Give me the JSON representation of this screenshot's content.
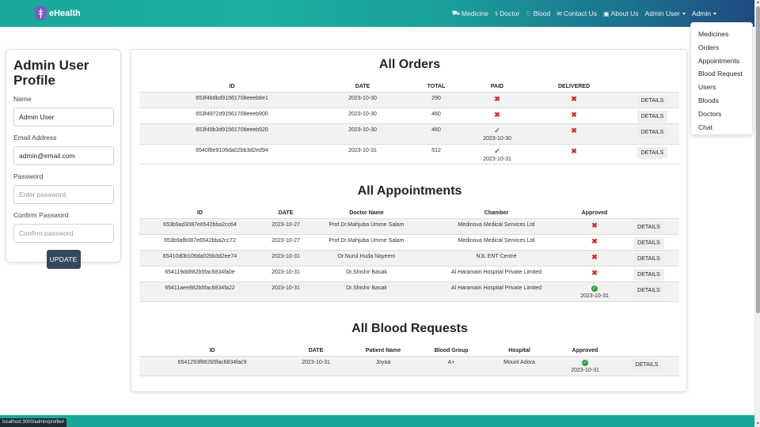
{
  "brand": {
    "name": "eHealth"
  },
  "nav": {
    "links": [
      {
        "label": "Medicine",
        "icon": "truck-medical-icon",
        "glyph": "🚑"
      },
      {
        "label": "Doctor",
        "icon": "stethoscope-icon",
        "glyph": "⚕"
      },
      {
        "label": "Blood",
        "icon": "hand-holding-droplet-icon",
        "glyph": "♡"
      },
      {
        "label": "Contact Us",
        "icon": "envelope-icon",
        "glyph": "✉"
      },
      {
        "label": "About Us",
        "icon": "address-card-icon",
        "glyph": "▣"
      }
    ],
    "admin_user_label": "Admin User",
    "admin_label": "Admin"
  },
  "admin_menu": {
    "items": [
      "Medicines",
      "Orders",
      "Appointments",
      "Blood Request",
      "Users",
      "Bloods",
      "Doctors",
      "Chat"
    ]
  },
  "profile": {
    "title": "Admin User Profile",
    "name_label": "Name",
    "name_value": "Admin User",
    "email_label": "Email Address",
    "email_value": "admin@email.com",
    "password_label": "Password",
    "password_placeholder": "Enter password",
    "confirm_label": "Confirm Password",
    "confirm_placeholder": "Confirm password",
    "update_label": "UPDATE"
  },
  "orders": {
    "title": "All Orders",
    "headers": [
      "ID",
      "DATE",
      "TOTAL",
      "PAID",
      "DELIVERED",
      ""
    ],
    "rows": [
      {
        "id": "653f48dbd91561708eeeb8e1",
        "date": "2023-10-30",
        "total": "290",
        "paid": false,
        "paid_date": "",
        "delivered": false,
        "action": "DETAILS"
      },
      {
        "id": "653f4972d91561708eeeb900",
        "date": "2023-10-30",
        "total": "460",
        "paid": false,
        "paid_date": "",
        "delivered": false,
        "action": "DETAILS"
      },
      {
        "id": "653f49b3d91561708eeeb920",
        "date": "2023-10-30",
        "total": "460",
        "paid": true,
        "paid_date": "2023-10-30",
        "delivered": false,
        "action": "DETAILS"
      },
      {
        "id": "6540f8e9106da02bb3d2ed94",
        "date": "2023-10-31",
        "total": "512",
        "paid": true,
        "paid_date": "2023-10-31",
        "delivered": false,
        "action": "DETAILS"
      }
    ]
  },
  "appointments": {
    "title": "All Appointments",
    "headers": [
      "ID",
      "DATE",
      "Doctor Name",
      "Chamber",
      "Approved",
      ""
    ],
    "rows": [
      {
        "id": "653b9ad3087e6542bba2cc64",
        "date": "2023-10-27",
        "doctor": "Prof.Dr.Mahjuba Umme Salam",
        "chamber": "Medinova Medical Services Ltd",
        "approved": false,
        "approved_date": "",
        "action": "DETAILS"
      },
      {
        "id": "653b9afb087e6542bba2cc72",
        "date": "2023-10-27",
        "doctor": "Prof.Dr.Mahjuba Umme Salam",
        "chamber": "Medinova Medical Services Ltd",
        "approved": false,
        "approved_date": "",
        "action": "DETAILS"
      },
      {
        "id": "65410d0b106da02bb3d2ee74",
        "date": "2023-10-31",
        "doctor": "Dr.Nurul Huda Nayeem",
        "chamber": "NJL ENT Centre",
        "approved": false,
        "approved_date": "",
        "action": "DETAILS"
      },
      {
        "id": "654119dd882b5fac6834fa0e",
        "date": "2023-10-31",
        "doctor": "Dr.Shishir Basak",
        "chamber": "Al Haramain Hospital Private Limited",
        "approved": false,
        "approved_date": "",
        "action": "DETAILS"
      },
      {
        "id": "65411aee882b5fac6834fa22",
        "date": "2023-10-31",
        "doctor": "Dr.Shishir Basak",
        "chamber": "Al Haramain Hospital Private Limited",
        "approved": true,
        "approved_date": "2023-10-31",
        "action": "DETAILS"
      }
    ]
  },
  "blood_requests": {
    "title": "All Blood Requests",
    "headers": [
      "ID",
      "DATE",
      "Patient Name",
      "Blood Group",
      "Hospital",
      "Approved",
      ""
    ],
    "rows": [
      {
        "id": "6541293f882b5fac6834fac9",
        "date": "2023-10-31",
        "patient": "Joyaa",
        "group": "A+",
        "hospital": "Mount Adora",
        "approved": true,
        "approved_date": "2023-10-31",
        "action": "DETAILS"
      }
    ]
  },
  "status_bar": {
    "url": "localhost:3000/admin/profile#"
  },
  "colors": {
    "navbar_start": "#1aa89a",
    "navbar_end": "#204a80",
    "reject": "#dc2626",
    "approve": "#198754",
    "button": "#34495e"
  }
}
